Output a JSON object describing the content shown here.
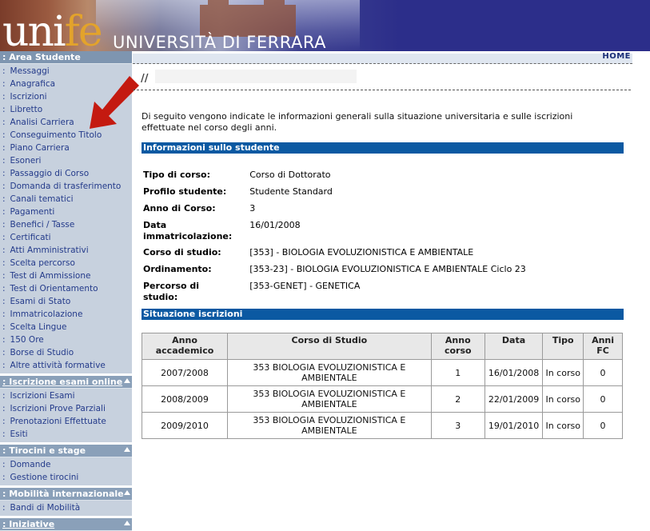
{
  "header": {
    "logo_left": "uni",
    "logo_accent": "fe",
    "logo_full": "UNIVERSITÀ DI FERRARA"
  },
  "sidebar": {
    "sections": [
      {
        "title": ": Area Studente",
        "underlined": false,
        "items": [
          "Messaggi",
          "Anagrafica",
          "Iscrizioni",
          "Libretto",
          "Analisi Carriera",
          "Conseguimento Titolo",
          "Piano Carriera",
          "Esoneri",
          "Passaggio di Corso",
          "Domanda di trasferimento",
          "Canali tematici",
          "Pagamenti",
          "Benefici / Tasse",
          "Certificati",
          "Atti Amministrativi",
          "Scelta percorso",
          "Test di Ammissione",
          "Test di Orientamento",
          "Esami di Stato",
          "Immatricolazione",
          "Scelta Lingue",
          "150 Ore",
          "Borse di Studio",
          "Altre attività formative"
        ]
      },
      {
        "title": ": Iscrizione esami online",
        "underlined": true,
        "items": [
          "Iscrizioni Esami",
          "Iscrizioni Prove Parziali",
          "Prenotazioni Effettuate",
          "Esiti"
        ]
      },
      {
        "title": ": Tirocini e stage",
        "underlined": false,
        "items": [
          "Domande",
          "Gestione tirocini"
        ]
      },
      {
        "title": ": Mobilità internazionale",
        "underlined": false,
        "items": [
          "Bandi di Mobilità"
        ]
      },
      {
        "title": ": Iniziative",
        "underlined": true,
        "items": []
      }
    ]
  },
  "topbar": {
    "home": "HOME"
  },
  "breadcrumb": {
    "text": "//"
  },
  "intro": "Di seguito vengono indicate le informazioni generali sulla situazione universitaria e sulle iscrizioni effettuate nel corso degli anni.",
  "info_section": {
    "title": "Informazioni sullo studente",
    "rows": [
      {
        "label": "Tipo di corso:",
        "value": "Corso di Dottorato"
      },
      {
        "label": "Profilo studente:",
        "value": "Studente Standard"
      },
      {
        "label": "Anno di Corso:",
        "value": "3"
      },
      {
        "label": "Data immatricolazione:",
        "value": "16/01/2008"
      },
      {
        "label": "Corso di studio:",
        "value": "[353] - BIOLOGIA EVOLUZIONISTICA E AMBIENTALE"
      },
      {
        "label": "Ordinamento:",
        "value": "[353-23] - BIOLOGIA EVOLUZIONISTICA E AMBIENTALE Ciclo 23"
      },
      {
        "label": "Percorso di studio:",
        "value": "[353-GENET] - GENETICA"
      }
    ]
  },
  "iscrizioni_section": {
    "title": "Situazione iscrizioni",
    "headers": [
      "Anno accademico",
      "Corso di Studio",
      "Anno corso",
      "Data",
      "Tipo",
      "Anni FC"
    ],
    "rows": [
      [
        "2007/2008",
        "353 BIOLOGIA EVOLUZIONISTICA E AMBIENTALE",
        "1",
        "16/01/2008",
        "In corso",
        "0"
      ],
      [
        "2008/2009",
        "353 BIOLOGIA EVOLUZIONISTICA E AMBIENTALE",
        "2",
        "22/01/2009",
        "In corso",
        "0"
      ],
      [
        "2009/2010",
        "353 BIOLOGIA EVOLUZIONISTICA E AMBIENTALE",
        "3",
        "19/01/2010",
        "In corso",
        "0"
      ]
    ]
  },
  "colors": {
    "header_bg": "#2c2e8a",
    "logo_accent": "#e3a32b",
    "sidebar_bg": "#c7d1de",
    "section_head": "#8aa0b9",
    "band": "#0b59a2",
    "link": "#233a8a",
    "arrow": "#c41a10"
  }
}
